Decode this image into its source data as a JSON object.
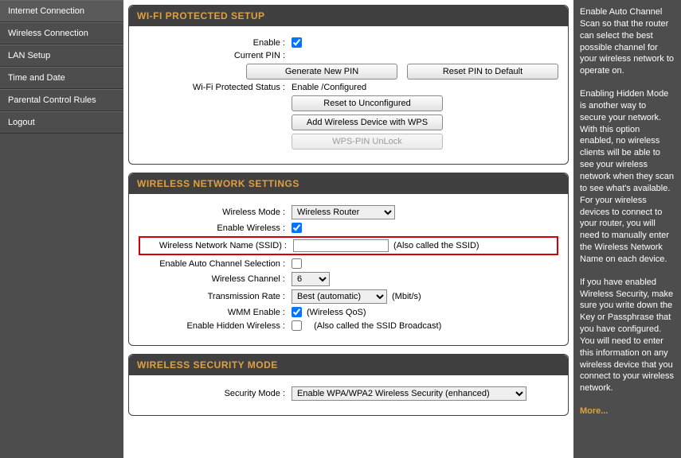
{
  "sidebar": {
    "items": [
      {
        "label": "Internet Connection"
      },
      {
        "label": "Wireless Connection"
      },
      {
        "label": "LAN Setup"
      },
      {
        "label": "Time and Date"
      },
      {
        "label": "Parental Control Rules"
      },
      {
        "label": "Logout"
      }
    ]
  },
  "panels": {
    "wps": {
      "title": "WI-FI PROTECTED SETUP",
      "enable_label": "Enable :",
      "enable_checked": true,
      "current_pin_label": "Current PIN :",
      "current_pin_value": "",
      "generate_pin_btn": "Generate New PIN",
      "reset_pin_btn": "Reset PIN to Default",
      "status_label": "Wi-Fi Protected Status :",
      "status_value": "Enable /Configured",
      "reset_unconfig_btn": "Reset to Unconfigured",
      "add_device_btn": "Add Wireless Device with WPS",
      "wps_unlock_btn": "WPS-PIN UnLock"
    },
    "wireless": {
      "title": "WIRELESS NETWORK SETTINGS",
      "mode_label": "Wireless Mode :",
      "mode_value": "Wireless Router",
      "enable_wireless_label": "Enable Wireless :",
      "enable_wireless_checked": true,
      "ssid_label": "Wireless Network Name (SSID) :",
      "ssid_value": "",
      "ssid_hint": "(Also called the SSID)",
      "auto_channel_label": "Enable Auto Channel Selection :",
      "auto_channel_checked": false,
      "channel_label": "Wireless Channel :",
      "channel_value": "6",
      "tx_rate_label": "Transmission Rate :",
      "tx_rate_value": "Best (automatic)",
      "tx_rate_unit": "(Mbit/s)",
      "wmm_label": "WMM Enable :",
      "wmm_checked": true,
      "wmm_hint": "(Wireless QoS)",
      "hidden_label": "Enable Hidden Wireless :",
      "hidden_checked": false,
      "hidden_hint": "(Also called the SSID Broadcast)"
    },
    "security": {
      "title": "WIRELESS SECURITY MODE",
      "mode_label": "Security Mode :",
      "mode_value": "Enable WPA/WPA2 Wireless Security (enhanced)"
    }
  },
  "help": {
    "p1": "Enable Auto Channel Scan so that the router can select the best possible channel for your wireless network to operate on.",
    "p2": "Enabling Hidden Mode is another way to secure your network. With this option enabled, no wireless clients will be able to see your wireless network when they scan to see what's available. For your wireless devices to connect to your router, you will need to manually enter the Wireless Network Name on each device.",
    "p3": "If you have enabled Wireless Security, make sure you write down the Key or Passphrase that you have configured. You will need to enter this information on any wireless device that you connect to your wireless network.",
    "more": "More..."
  }
}
